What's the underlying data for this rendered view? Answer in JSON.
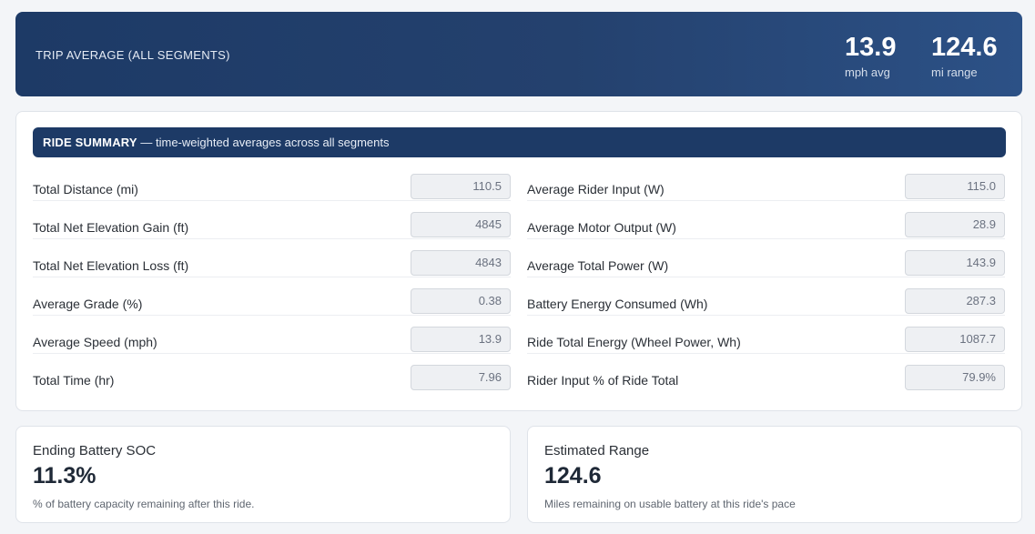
{
  "banner": {
    "title": "TRIP AVERAGE (ALL SEGMENTS)",
    "speed_value": "13.9",
    "speed_unit": "mph avg",
    "range_value": "124.6",
    "range_unit": "mi range"
  },
  "summary": {
    "header_bold": "RIDE SUMMARY",
    "header_rest": " — time-weighted averages across all segments",
    "left_rows": [
      {
        "label": "Total Distance (mi)",
        "value": "110.5"
      },
      {
        "label": "Total Net Elevation Gain (ft)",
        "value": "4845"
      },
      {
        "label": "Total Net Elevation Loss (ft)",
        "value": "4843"
      },
      {
        "label": "Average Grade (%)",
        "value": "0.38"
      },
      {
        "label": "Average Speed (mph)",
        "value": "13.9"
      },
      {
        "label": "Total Time (hr)",
        "value": "7.96"
      }
    ],
    "right_rows": [
      {
        "label": "Average Rider Input (W)",
        "value": "115.0"
      },
      {
        "label": "Average Motor Output (W)",
        "value": "28.9"
      },
      {
        "label": "Average Total Power (W)",
        "value": "143.9"
      },
      {
        "label": "Battery Energy Consumed (Wh)",
        "value": "287.3"
      },
      {
        "label": "Ride Total Energy (Wheel Power, Wh)",
        "value": "1087.7"
      },
      {
        "label": "Rider Input % of Ride Total",
        "value": "79.9%"
      }
    ]
  },
  "soc_card": {
    "title": "Ending Battery SOC",
    "value": "11.3%",
    "description": "% of battery capacity remaining after this ride."
  },
  "range_card": {
    "title": "Estimated Range",
    "value": "124.6",
    "description": "Miles remaining on usable battery at this ride's pace"
  }
}
